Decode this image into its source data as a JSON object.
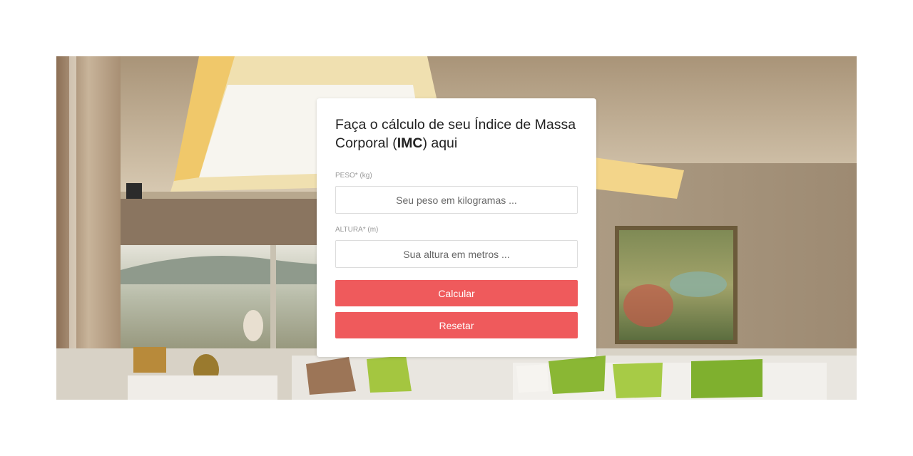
{
  "form": {
    "title_prefix": "Faça o cálculo de seu Índice de Massa Corporal (",
    "title_bold": "IMC",
    "title_suffix": ") aqui",
    "weight_label": "PESO* (kg)",
    "weight_placeholder": "Seu peso em kilogramas ...",
    "weight_value": "",
    "height_label": "ALTURA* (m)",
    "height_placeholder": "Sua altura em metros ...",
    "height_value": "",
    "calculate_label": "Calcular",
    "reset_label": "Resetar"
  },
  "theme": {
    "accent": "#ef5a5c",
    "card_background": "#ffffff"
  }
}
